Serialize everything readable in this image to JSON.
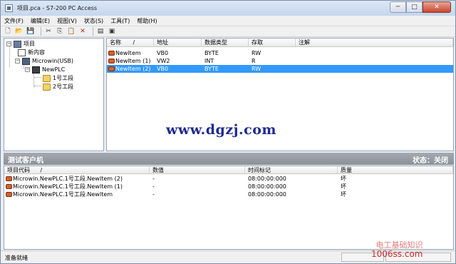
{
  "window": {
    "title": "项目.pca - S7-200 PC Access",
    "controls": {
      "minimize": "─",
      "maximize": "□",
      "close": "✕"
    }
  },
  "menu": [
    "文件(F)",
    "编辑(E)",
    "视图(V)",
    "状态(S)",
    "工具(T)",
    "帮助(H)"
  ],
  "toolbar": {
    "icons": [
      "new-file-icon",
      "open-folder-icon",
      "save-icon",
      "cut-icon",
      "copy-icon",
      "paste-icon",
      "delete-icon",
      "properties-icon",
      "test-client-icon"
    ],
    "glyphs": [
      "🗋",
      "📂",
      "💾",
      "✂",
      "⎘",
      "📋",
      "✕",
      "▤",
      "▣"
    ]
  },
  "tree": {
    "root": "项目",
    "items": [
      "新内容",
      "Microwin(USB)",
      "NewPLC",
      "1号工段",
      "2号工段"
    ]
  },
  "list": {
    "columns": [
      "名称",
      "地址",
      "数据类型",
      "存取",
      "注解"
    ],
    "sort_indicator": "/",
    "rows": [
      {
        "name": "NewItem",
        "address": "VB0",
        "type": "BYTE",
        "access": "RW",
        "comment": ""
      },
      {
        "name": "NewItem (1)",
        "address": "VW2",
        "type": "INT",
        "access": "R",
        "comment": ""
      },
      {
        "name": "NewItem (2)",
        "address": "VB0",
        "type": "BYTE",
        "access": "RW",
        "comment": ""
      }
    ]
  },
  "watermark": "www.dgzj.com",
  "client": {
    "title": "测试客户机",
    "status": "状态：关闭",
    "columns": [
      "项目代码",
      "数值",
      "时间标记",
      "质量"
    ],
    "sort_indicator": "/",
    "rows": [
      {
        "code": "Microwin.NewPLC.1号工段.NewItem (2)",
        "value": "-",
        "time": "08:00:00:000",
        "quality": "坏"
      },
      {
        "code": "Microwin.NewPLC.1号工段.NewItem (1)",
        "value": "-",
        "time": "08:00:00:000",
        "quality": "坏"
      },
      {
        "code": "Microwin.NewPLC.1号工段.NewItem",
        "value": "-",
        "time": "08:00:00:000",
        "quality": "坏"
      }
    ]
  },
  "statusbar": {
    "text": "准备就绪"
  },
  "corner_watermark": {
    "line1": "电工基础知识",
    "line2": "1006ss.com"
  }
}
